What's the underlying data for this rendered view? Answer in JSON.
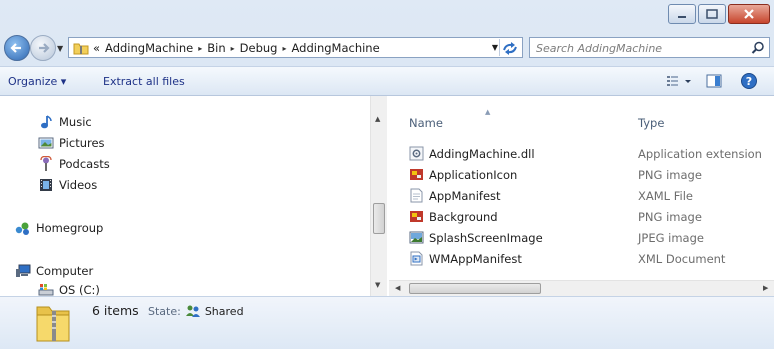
{
  "window": {
    "caption_buttons": [
      "minimize",
      "maximize",
      "close"
    ]
  },
  "address": {
    "overflow": "«",
    "crumbs": [
      "AddingMachine",
      "Bin",
      "Debug",
      "AddingMachine"
    ],
    "separator": "▸"
  },
  "search": {
    "placeholder": "Search AddingMachine"
  },
  "toolbar": {
    "organize": "Organize ▾",
    "extract": "Extract all files",
    "views_icon": "view-options-icon",
    "preview_icon": "preview-pane-icon",
    "help_icon": "help-icon"
  },
  "nav": {
    "items": [
      {
        "label": "Music",
        "icon": "music-icon"
      },
      {
        "label": "Pictures",
        "icon": "pictures-icon"
      },
      {
        "label": "Podcasts",
        "icon": "podcasts-icon"
      },
      {
        "label": "Videos",
        "icon": "videos-icon"
      },
      {
        "label": "Homegroup",
        "icon": "homegroup-icon"
      },
      {
        "label": "Computer",
        "icon": "computer-icon"
      },
      {
        "label": "OS (C:)",
        "icon": "drive-icon"
      }
    ]
  },
  "files": {
    "columns": [
      "Name",
      "Type"
    ],
    "rows": [
      {
        "name": "AddingMachine.dll",
        "type": "Application extension",
        "icon": "dll-icon"
      },
      {
        "name": "ApplicationIcon",
        "type": "PNG image",
        "icon": "png-icon"
      },
      {
        "name": "AppManifest",
        "type": "XAML File",
        "icon": "xaml-icon"
      },
      {
        "name": "Background",
        "type": "PNG image",
        "icon": "png-icon"
      },
      {
        "name": "SplashScreenImage",
        "type": "JPEG image",
        "icon": "jpeg-icon"
      },
      {
        "name": "WMAppManifest",
        "type": "XML Document",
        "icon": "xml-icon"
      }
    ]
  },
  "details": {
    "count": "6 items",
    "state_label": "State:",
    "state_value": "Shared"
  },
  "colors": {
    "chrome": "#dfe9f5",
    "toolbar_text": "#1e3287",
    "type_text": "#6d6d6d"
  }
}
